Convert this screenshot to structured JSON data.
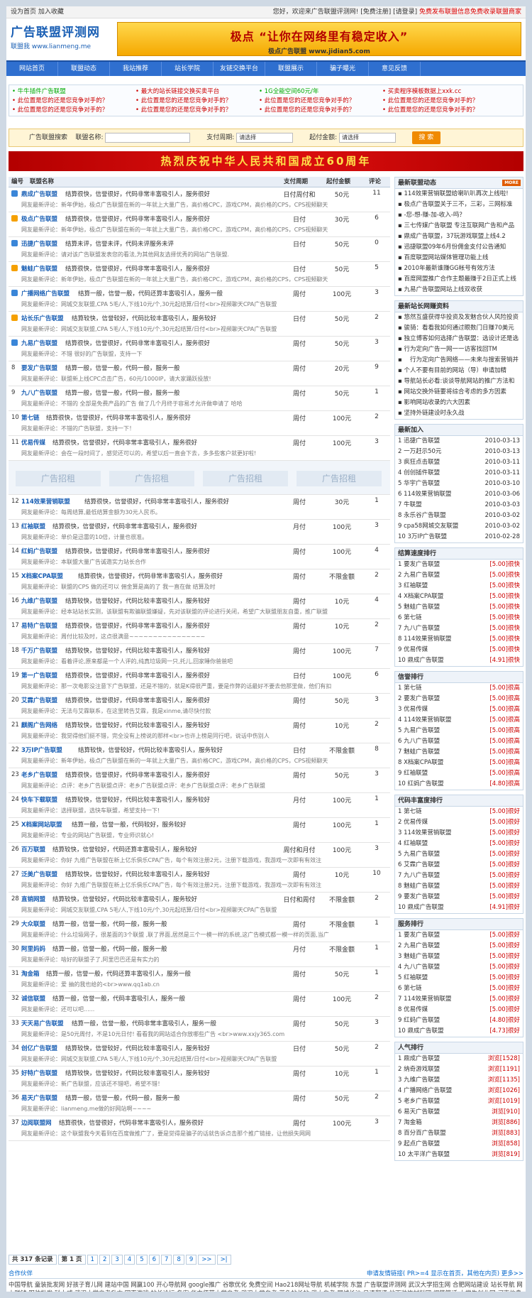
{
  "topbar": {
    "left": "设为首页  加入收藏",
    "right": "您好，欢迎来广告联盟评测网!  [免费注册]  [请登录]",
    "right_red": "免费发布联盟信息免费收录联盟商家"
  },
  "logo": {
    "title": "广告联盟评测网",
    "subtitle": "联盟我  www.lianmeng.me"
  },
  "banner": {
    "line1": "极点 “让你在网络里有稳定收入”",
    "line2": "极点广告联盟 www.jidian5.com"
  },
  "nav": [
    "网站首页",
    "联盟动态",
    "我站推荐",
    "站长学院",
    "友链交换平台",
    "联盟展示",
    "骗子曝光",
    "意见反馈"
  ],
  "links": [
    {
      "t": "• 牛牛插件广告联盟",
      "g": true
    },
    {
      "t": "• 最大的站长链接交换买卖平台",
      "g": false
    },
    {
      "t": "• 1G全能空间60元/年",
      "g": true
    },
    {
      "t": "• 买卖程序模板数据上xxk.cc",
      "g": false
    },
    {
      "t": "• 此位置是您的还是您竞争对手的？",
      "g": false
    },
    {
      "t": "• 此位置是您的还是您竞争对手的？",
      "g": false
    },
    {
      "t": "• 此位置是您的还是您竞争对手的？",
      "g": false
    },
    {
      "t": "• 此位置是您的还是您竞争对手的？",
      "g": false
    },
    {
      "t": "• 此位置是您的还是您竞争对手的？",
      "g": false
    },
    {
      "t": "• 此位置是您的还是您竞争对手的？",
      "g": false
    },
    {
      "t": "• 此位置是您的还是您竞争对手的？",
      "g": false
    },
    {
      "t": "• 此位置是您的还是您竞争对手的？",
      "g": false
    }
  ],
  "search": {
    "label": "广告联盟搜索",
    "name_label": "联盟名称:",
    "period_label": "支付周期:",
    "period_value": "请选择",
    "min_label": "起付金额:",
    "min_value": "请选择",
    "button": "搜 索"
  },
  "festival": "热烈庆祝中华人民共和国成立60周年",
  "table": {
    "headers": [
      "编号",
      "联盟名称",
      "支付周期",
      "起付金额",
      "评论"
    ],
    "rows": [
      {
        "n": "",
        "nm": "鼎成广告联盟",
        "ds": "结算很快，信誉很好，代码非常丰富吸引人，服务很好",
        "cm": "网友最新评论：新年伊始，极点广告联盟在新的一年就上大量广告，高价格CPC，游戏CPM，高价格的CPS，CPS视频聊天",
        "pr": "日付周付和",
        "mn": "50元",
        "cc": "11"
      },
      {
        "n": "",
        "nm": "极点广告联盟",
        "ds": "结算很快，信誉很好，代码非常丰富吸引人，服务很好",
        "cm": "网友最新评论：新年伊始，极点广告联盟在新的一年就上大量广告，高价格CPC，游戏CPM，高价格的CPS，CPS视频聊天",
        "pr": "日付",
        "mn": "30元",
        "cc": "6"
      },
      {
        "n": "",
        "nm": "迅捷广告联盟",
        "ds": "结算未评，信誉未评，代码未评服务未评",
        "cm": "网友最新评论：请对该广告联盟发表您的看法,为其他网友选择优秀的网站广告联盟.",
        "pr": "日付",
        "mn": "50元",
        "cc": "0"
      },
      {
        "n": "",
        "nm": "魅蛙广告联盟",
        "ds": "结算很快，信誉很好，代码非常丰富吸引人，服务很好",
        "cm": "网友最新评论：新年伊始，极点广告联盟在新的一年就上大量广告，高价格CPC，游戏CPM，高价格的CPS，CPS视频聊天",
        "pr": "日付",
        "mn": "50元",
        "cc": "5"
      },
      {
        "n": "",
        "nm": "广播网络广告联盟",
        "ds": "结算一般，信誉一般，代码还算丰富吸引人，服务一般",
        "cm": "网友最新评论：网城交友联盟,CPA 5毛/人,下线10元/个,30元起结算/日付<br>视频聊天CPA广告联盟",
        "pr": "周付",
        "mn": "100元",
        "cc": "3"
      },
      {
        "n": "",
        "nm": "站长乐广告联盟",
        "ds": "结算较快，信誉较好，代码比较丰富吸引人，服务较好",
        "cm": "网友最新评论：网城交友联盟,CPA 5毛/人,下线10元/个,30元起结算/日付<br>视频聊天CPA广告联盟",
        "pr": "日付",
        "mn": "50元",
        "cc": "2"
      },
      {
        "n": "",
        "nm": "九易广告联盟",
        "ds": "结算很快，信誉很好，代码非常丰富吸引人，服务很好",
        "cm": "网友最新评论：不错 很好的广告联盟，支持一下",
        "pr": "周付",
        "mn": "50元",
        "cc": "3"
      },
      {
        "n": "8",
        "nm": "要发广告联盟",
        "ds": "结算一般，信誉一般，代码一般，服务一般",
        "cm": "网友最新评论：联盟新上线CPC点击广告，60元/1000IP，请大家踊跃投放!",
        "pr": "周付",
        "mn": "20元",
        "cc": "9"
      },
      {
        "n": "9",
        "nm": "九八广告联盟",
        "ds": "结算一般，信誉一般，代码一般，服务一般",
        "cm": "网友最新评论：不错的 全部是免费产品的广告 做了几个月终于容易才允许做申请了 哈哈",
        "pr": "周付",
        "mn": "50元",
        "cc": "1"
      },
      {
        "n": "10",
        "nm": "第七链",
        "ds": "结算很快，信誉很好，代码非常丰富吸引人，服务很好",
        "cm": "网友最新评论：不错的广告联盟，支持一下！",
        "pr": "周付",
        "mn": "100元",
        "cc": "2"
      },
      {
        "n": "11",
        "nm": "优易传媒",
        "ds": "结算很快，信誉很好，代码非常丰富吸引人，服务很好",
        "cm": "网友最新评论：会在一段时间了，感觉还可以的，希望以后一直会下去，多多些客户就更好啦!",
        "pr": "周付",
        "mn": "100元",
        "cc": "3"
      }
    ],
    "ad_text": [
      "广告招租",
      "广告招租",
      "广告招租",
      "广告招租"
    ],
    "rows2": [
      {
        "n": "12",
        "nm": "114效果营销联盟",
        "ds": "结算很快，信誉很好，代码非常丰富吸引人，服务很好",
        "cm": "网友最新评论：每周结算,最低结算金额为30元人民币。",
        "pr": "周付",
        "mn": "30元",
        "cc": "1"
      },
      {
        "n": "13",
        "nm": "红袖联盟",
        "ds": "结算很快，信誉很好，代码非常丰富吸引人，服务很好",
        "cm": "网友最新评论：单价是迅雷的10倍，计量也很准。",
        "pr": "月付",
        "mn": "100元",
        "cc": "3"
      },
      {
        "n": "14",
        "nm": "红蚂广告联盟",
        "ds": "结算很快，信誉很好，代码非常丰富吸引人，服务很好",
        "cm": "网友最新评论：本联盟大量广告诚邀实力站长合作",
        "pr": "周付",
        "mn": "100元",
        "cc": "4"
      },
      {
        "n": "15",
        "nm": "X档案CPA联盟",
        "ds": "结算很快，信誉很好，代码非常丰富吸引人，服务很好",
        "cm": "网友最新评论：联盟的CPS 做的还可以 佣金算是高的了 我一直在做 结算及时",
        "pr": "周付",
        "mn": "不限金额",
        "cc": "2"
      },
      {
        "n": "16",
        "nm": "九维广告联盟",
        "ds": "结算较快，信誉较好，代码比较丰富吸引人，服务较好",
        "cm": "网友最新评论：经本站站长实测，该联盟有欺骗联盟嫌疑，先对该联盟的评论进行关闭，希望广大联盟朋友自重，推广联盟",
        "pr": "周付",
        "mn": "10元",
        "cc": "4"
      },
      {
        "n": "17",
        "nm": "易特广告联盟",
        "ds": "结算很快，信誉很好，代码非常丰富吸引人，服务很好",
        "cm": "网友最新评论：周付比较及时，这点很满意~~~~~~~~~~~~~~~~",
        "pr": "周付",
        "mn": "10元",
        "cc": "2"
      },
      {
        "n": "18",
        "nm": "千万广告联盟",
        "ds": "结算较快，信誉较好，代码比较丰富吸引人，服务较好",
        "cm": "网友最新评论：看着评论,原来都是一个人评的,纯真垃圾网一只,托儿,回家睡你爸爸吧",
        "pr": "周付",
        "mn": "100元",
        "cc": "7"
      },
      {
        "n": "19",
        "nm": "第一广告联盟",
        "ds": "结算很快，信誉很好，代码非常丰富吸引人，服务很好",
        "cm": "网友最新评论：那一次电影没注意下广告联盟，还是不错的，就是K得很严重，要是作弊的话最好不要去他那里做，他们有扣",
        "pr": "日付",
        "mn": "100元",
        "cc": "6"
      },
      {
        "n": "20",
        "nm": "艾霖广告联盟",
        "ds": "结算很快，信誉很好，代码非常丰富吸引人，服务很好",
        "cm": "网友最新评论：无法与艾霖联系，在这里转告艾霖，我是xinme,请尽快付款",
        "pr": "周付",
        "mn": "50元",
        "cc": "3"
      },
      {
        "n": "21",
        "nm": "麒阁广告网络",
        "ds": "结算较快，信誉较好，代码比较丰富吸引人，服务较好",
        "cm": "网友最新评论：我觉得他们挺不错，完全没有上榜说的那样<br>也许上榜是同行吧，说话中伤别人",
        "pr": "周付",
        "mn": "10元",
        "cc": "2"
      },
      {
        "n": "22",
        "nm": "3万IP广告联盟",
        "ds": "结算较快，信誉较好，代码比较丰富吸引人，服务较好",
        "cm": "网友最新评论：新年伊始，极点广告联盟在新的一年就上大量广告，高价格CPC，游戏CPM，高价格的CPS，CPS视频聊天",
        "pr": "日付",
        "mn": "不限金额",
        "cc": "8"
      },
      {
        "n": "23",
        "nm": "老乡广告联盟",
        "ds": "结算很快，信誉很好，代码非常丰富吸引人，服务很好",
        "cm": "网友最新评论：点评：老乡广告联盟点评：老乡广告联盟点评：老乡广告联盟点评：老乡广告联盟",
        "pr": "周付",
        "mn": "50元",
        "cc": "3"
      },
      {
        "n": "24",
        "nm": "快车下载联盟",
        "ds": "结算较快，信誉较好，代码比较丰富吸引人，服务较好",
        "cm": "网友最新评论：选择联盟，选快车联盟，希望支持一下!",
        "pr": "月付",
        "mn": "100元",
        "cc": "1"
      },
      {
        "n": "25",
        "nm": "X档案网站联盟",
        "ds": "结算一般，信誉一般，代码较好，服务较好",
        "cm": "网友最新评论：专业的网站广告联盟，专业师识就心!",
        "pr": "周付",
        "mn": "100元",
        "cc": "1"
      },
      {
        "n": "26",
        "nm": "百万联盟",
        "ds": "结算较快，信誉较好，代码还算丰富吸引人，服务较好",
        "cm": "网友最新评论：你好 九维广告联盟在新上亿乐俱乐CPA广告，每个有效注册2元，注册下载游戏，我游戏一次即有有效注",
        "pr": "周付和月付",
        "mn": "100元",
        "cc": "3"
      },
      {
        "n": "27",
        "nm": "泛美广告联盟",
        "ds": "结算较快，信誉较好，代码比较丰富吸引人，服务较好",
        "cm": "网友最新评论：你好 九维广告联盟在新上亿乐俱乐CPA广告，每个有效注册2元，注册下载游戏，我游戏一次即有有效注",
        "pr": "周付",
        "mn": "10元",
        "cc": "10"
      },
      {
        "n": "28",
        "nm": "直销网盟",
        "ds": "结算较快，信誉较好，代码比较丰富吸引人，服务较好",
        "cm": "网友最新评论：网城交友联盟,CPA 5毛/人,下线10元/个,30元起结算/日付<br>视频聊天CPA广告联盟",
        "pr": "日付和周付",
        "mn": "不限金额",
        "cc": "2"
      },
      {
        "n": "29",
        "nm": "大众联盟",
        "ds": "结算一般，信誉一般，代码一般，服务一般",
        "cm": "网友最新评论：什么垃圾网子，很差面的3个联盟 ,联了界面,居然是三个一模一样的系统,这广告模式都一模一样的页面,当广",
        "pr": "周付",
        "mn": "不限金额",
        "cc": "1"
      },
      {
        "n": "30",
        "nm": "阿里妈妈",
        "ds": "结算一般，信誉一般，代码一般，服务一般",
        "cm": "网友最新评论：啥好的联盟子了,阿里巴巴还是有实力的",
        "pr": "月付",
        "mn": "不限金额",
        "cc": "1"
      },
      {
        "n": "31",
        "nm": "淘金箱",
        "ds": "结算一般，信誉一般，代码还算丰富吸引人，服务一般",
        "cm": "网友最新评论：爱 抽的我也给的<br>www.qq1ab.cn",
        "pr": "周付",
        "mn": "50元",
        "cc": "1"
      },
      {
        "n": "32",
        "nm": "诚信联盟",
        "ds": "结算一般，信誉一般，代码丰富吸引人，服务一般",
        "cm": "网友最新评论：还可以吧......",
        "pr": "周付",
        "mn": "100元",
        "cc": "2"
      },
      {
        "n": "33",
        "nm": "天天易广告联盟",
        "ds": "结算一般，信誉一般，代码非常丰富吸引人，服务一般",
        "cm": "网友最新评论：是50元周付，不是10元日付! 看看我的网站适合你放哪些广告 <br>www.xxjy365.com",
        "pr": "周付",
        "mn": "50元",
        "cc": "3"
      },
      {
        "n": "34",
        "nm": "创亿广告联盟",
        "ds": "结算较快，信誉较好，代码比较丰富吸引人，服务较好",
        "cm": "网友最新评论：网城交友联盟,CPA 5毛/人,下线10元/个,30元起结算/日付<br>视频聊天CPA广告联盟",
        "pr": "日付",
        "mn": "50元",
        "cc": "2"
      },
      {
        "n": "35",
        "nm": "好特广告联盟",
        "ds": "结算较快，信誉较好，代码比较丰富吸引人，服务较好",
        "cm": "网友最新评论：新广告联盟，应该还不错吧，希望不错！",
        "pr": "周付",
        "mn": "10元",
        "cc": "1"
      },
      {
        "n": "36",
        "nm": "易天广告联盟",
        "ds": "结算一般，信誉一般，代码一般，服务一般",
        "cm": "网友最新评论：lianmeng.me做的好网站啊~~~~",
        "pr": "周付",
        "mn": "50元",
        "cc": "2"
      },
      {
        "n": "37",
        "nm": "边阅联盟网",
        "ds": "结算很快，信誉很好，代码非常丰富吸引人，服务很好",
        "cm": "网友最新评论：这个联盟我今天看到在百度做推广了，要是觉得是骗子的话就告诉点击那个推广链接，让他损失网网",
        "pr": "周付",
        "mn": "100元",
        "cc": "3"
      }
    ]
  },
  "pager": {
    "total": "共 317 条记录",
    "page": "第 1 页",
    "pages": [
      "1",
      "2",
      "3",
      "4",
      "5",
      "6",
      "7",
      "8",
      "9",
      ">>",
      ">|"
    ]
  },
  "sidebar": {
    "news": {
      "title": "最新联盟动态",
      "more": "MORE",
      "items": [
        "114效果营销联盟给喇叭叭再次上线啦!",
        "极点广告联盟关于三不，三彩，三网标准",
        "-您-想-赚-加-收入-吗？",
        "三七传媒广告联盟 专注互联网广告和产品",
        "鼎成广告联盟，37玩游戏联盟上线4.2",
        "迅捷联盟09年6月份佣金支付公告通知",
        "百度联盟网站媒体管理功能上线",
        "2010年最新谁赚GG帐号有效方法",
        "百度网盟推广合作主题最赚于2日正式上线",
        "九易广告联盟网站上线双收获"
      ]
    },
    "docs": {
      "title": "最新站长网赚资料",
      "items": [
        "悠然互盛获得华投资及发魅合伙人风险投资",
        "骏骑：看看我如何通过眼数门日赚70美元",
        "独立博客如何选择广告联盟：选设计还是选",
        "行为定向广告一网一一访客找回TM",
        "　行为定向广告网络——未来与搜索营销并",
        "个人不要有目前的网站（导）申请加精",
        "导航站长必看:谈谈导航网站的推广方法和",
        "网站交换外链要将综合考虑的多方因素",
        "影响网站收录的六大因素",
        "坚持外链建设时永久战"
      ]
    },
    "newjoin": {
      "title": "最新加入",
      "items": [
        {
          "t": "1  迅捷广告联盟",
          "r": "2010-03-13"
        },
        {
          "t": "2  一万赶示50元",
          "r": "2010-03-13"
        },
        {
          "t": "3  疯狂点击联盟",
          "r": "2010-03-11"
        },
        {
          "t": "4  创创插件联盟",
          "r": "2010-03-11"
        },
        {
          "t": "5  华宇广告联盟",
          "r": "2010-03-10"
        },
        {
          "t": "6  114效果营销联盟",
          "r": "2010-03-06"
        },
        {
          "t": "7  牛联盟",
          "r": "2010-03-03"
        },
        {
          "t": "8  永乐谷广告联盟",
          "r": "2010-03-02"
        },
        {
          "t": "9  cpa58网城交友联盟",
          "r": "2010-03-02"
        },
        {
          "t": "10 3万IP广告联盟",
          "r": "2010-02-28"
        }
      ]
    },
    "speed": {
      "title": "结算速度排行",
      "items": [
        {
          "t": "1  要发广告联盟",
          "r": "[5.00]很快"
        },
        {
          "t": "2  九易广告联盟",
          "r": "[5.00]很快"
        },
        {
          "t": "3  红袖联盟",
          "r": "[5.00]很快"
        },
        {
          "t": "4  X档案CPA联盟",
          "r": "[5.00]很快"
        },
        {
          "t": "5  魅蛙广告联盟",
          "r": "[5.00]很快"
        },
        {
          "t": "6  第七链",
          "r": "[5.00]很快"
        },
        {
          "t": "7  九八广告联盟",
          "r": "[5.00]很快"
        },
        {
          "t": "8  114效果营销联盟",
          "r": "[5.00]很快"
        },
        {
          "t": "9  优易传媒",
          "r": "[5.00]很快"
        },
        {
          "t": "10 鼎成广告联盟",
          "r": "[4.91]很快"
        }
      ]
    },
    "credit": {
      "title": "信誉排行",
      "items": [
        {
          "t": "1  第七链",
          "r": "[5.00]很高"
        },
        {
          "t": "2  要发广告联盟",
          "r": "[5.00]很高"
        },
        {
          "t": "3  优易传媒",
          "r": "[5.00]很高"
        },
        {
          "t": "4  114效果营销联盟",
          "r": "[5.00]很高"
        },
        {
          "t": "5  九易广告联盟",
          "r": "[5.00]很高"
        },
        {
          "t": "6  九八广告联盟",
          "r": "[5.00]很高"
        },
        {
          "t": "7  魅蛙广告联盟",
          "r": "[5.00]很高"
        },
        {
          "t": "8  X档案CPA联盟",
          "r": "[5.00]很高"
        },
        {
          "t": "9  红袖联盟",
          "r": "[5.00]很高"
        },
        {
          "t": "10 红蚂广告联盟",
          "r": "[4.80]很高"
        }
      ]
    },
    "code": {
      "title": "代码丰富度排行",
      "items": [
        {
          "t": "1  第七链",
          "r": "[5.00]很好"
        },
        {
          "t": "2  优易传媒",
          "r": "[5.00]很好"
        },
        {
          "t": "3  114效果营销联盟",
          "r": "[5.00]很好"
        },
        {
          "t": "4  红袖联盟",
          "r": "[5.00]很好"
        },
        {
          "t": "5  九易广告联盟",
          "r": "[5.00]很好"
        },
        {
          "t": "6  艾霖广告联盟",
          "r": "[5.00]很好"
        },
        {
          "t": "7  九八广告联盟",
          "r": "[5.00]很好"
        },
        {
          "t": "8  魅蛙广告联盟",
          "r": "[5.00]很好"
        },
        {
          "t": "9  要发广告联盟",
          "r": "[5.00]很好"
        },
        {
          "t": "10 鼎成广告联盟",
          "r": "[4.91]很好"
        }
      ]
    },
    "service": {
      "title": "服务排行",
      "items": [
        {
          "t": "1  要发广告联盟",
          "r": "[5.00]很好"
        },
        {
          "t": "2  九易广告联盟",
          "r": "[5.00]很好"
        },
        {
          "t": "3  魅蛙广告联盟",
          "r": "[5.00]很好"
        },
        {
          "t": "4  九八广告联盟",
          "r": "[5.00]很好"
        },
        {
          "t": "5  红袖联盟",
          "r": "[5.00]很好"
        },
        {
          "t": "6  第七链",
          "r": "[5.00]很好"
        },
        {
          "t": "7  114效果营销联盟",
          "r": "[5.00]很好"
        },
        {
          "t": "8  优易传媒",
          "r": "[5.00]很好"
        },
        {
          "t": "9  红蚂广告联盟",
          "r": "[4.80]很好"
        },
        {
          "t": "10 鼎成广告联盟",
          "r": "[4.73]很好"
        }
      ]
    },
    "popular": {
      "title": "人气排行",
      "items": [
        {
          "t": "1  鼎成广告联盟",
          "r": "浏览[1528]"
        },
        {
          "t": "2  纳奇游戏联盟",
          "r": "浏览[1191]"
        },
        {
          "t": "3  九维广告联盟",
          "r": "浏览[1135]"
        },
        {
          "t": "4  广播网络广告联盟",
          "r": "浏览[1026]"
        },
        {
          "t": "5  老乡广告联盟",
          "r": "浏览[1019]"
        },
        {
          "t": "6  易天广告联盟",
          "r": "浏览[910]"
        },
        {
          "t": "7  淘金箱",
          "r": "浏览[886]"
        },
        {
          "t": "8  百分百广告联盟",
          "r": "浏览[883]"
        },
        {
          "t": "9  起点广告联盟",
          "r": "浏览[858]"
        },
        {
          "t": "10 太平洋广告联盟",
          "r": "浏览[819]"
        }
      ]
    }
  },
  "partners": {
    "title": "合作伙伴",
    "right": "申请友情链接( PR>=4 显示在首页，其他在内页)  更多>>",
    "links": "中国导航  童装批发网  好孩子育儿网  建站中国  网赢100  开心导航网  google推广  谷歌优化  免费空间  Hao218网址导航  机械学院  东盟  广告联盟评测网  武汉大学招生网  合肥网站建设  站长导航  网上赚钱  服装批发  科士威  武汉大学自考升本  网页游戏  站长论坛  备案  华中师范大学自考  武汉大学自考  蓝色站长站  武大自考  犀城长沙  日语翻译  地面装饰材料网  爆笑笑话  大学生创业网  河南信息网  斗地主比赛  广播广告联盟  热土站长论坛  广告联盟评测网"
  }
}
